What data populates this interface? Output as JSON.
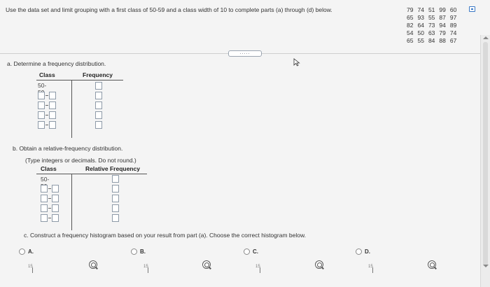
{
  "instructions": "Use the data set and limit grouping with a first class of 50-59 and a class width of 10 to complete parts (a) through (d) below.",
  "data_set": [
    [
      "79",
      "74",
      "51",
      "99",
      "60"
    ],
    [
      "65",
      "93",
      "55",
      "87",
      "97"
    ],
    [
      "82",
      "64",
      "73",
      "94",
      "89"
    ],
    [
      "54",
      "50",
      "63",
      "79",
      "74"
    ],
    [
      "65",
      "55",
      "84",
      "88",
      "67"
    ]
  ],
  "part_a": {
    "prompt": "a. Determine a frequency distribution.",
    "col_class": "Class",
    "col_frequency": "Frequency",
    "first_class": "50-59"
  },
  "part_b": {
    "prompt": "b. Obtain a relative-frequency distribution.",
    "hint": "(Type integers or decimals. Do not round.)",
    "col_class": "Class",
    "col_relative_frequency": "Relative Frequency",
    "first_class": "50-59"
  },
  "part_c": {
    "prompt": "c. Construct a frequency histogram based on your result from part (a). Choose the correct histogram below.",
    "options": [
      {
        "letter": "A.",
        "axis_label": "15"
      },
      {
        "letter": "B.",
        "axis_label": "15"
      },
      {
        "letter": "C.",
        "axis_label": "15"
      },
      {
        "letter": "D.",
        "axis_label": "15"
      }
    ]
  },
  "divider_handle": ".....",
  "icons": {
    "copy": "copy-icon",
    "zoom": "zoom-icon",
    "cursor": "cursor-arrow-icon"
  },
  "colors": {
    "accent": "#3a78c4",
    "input_border": "#8e9aa8",
    "background": "#f4f4f4"
  }
}
